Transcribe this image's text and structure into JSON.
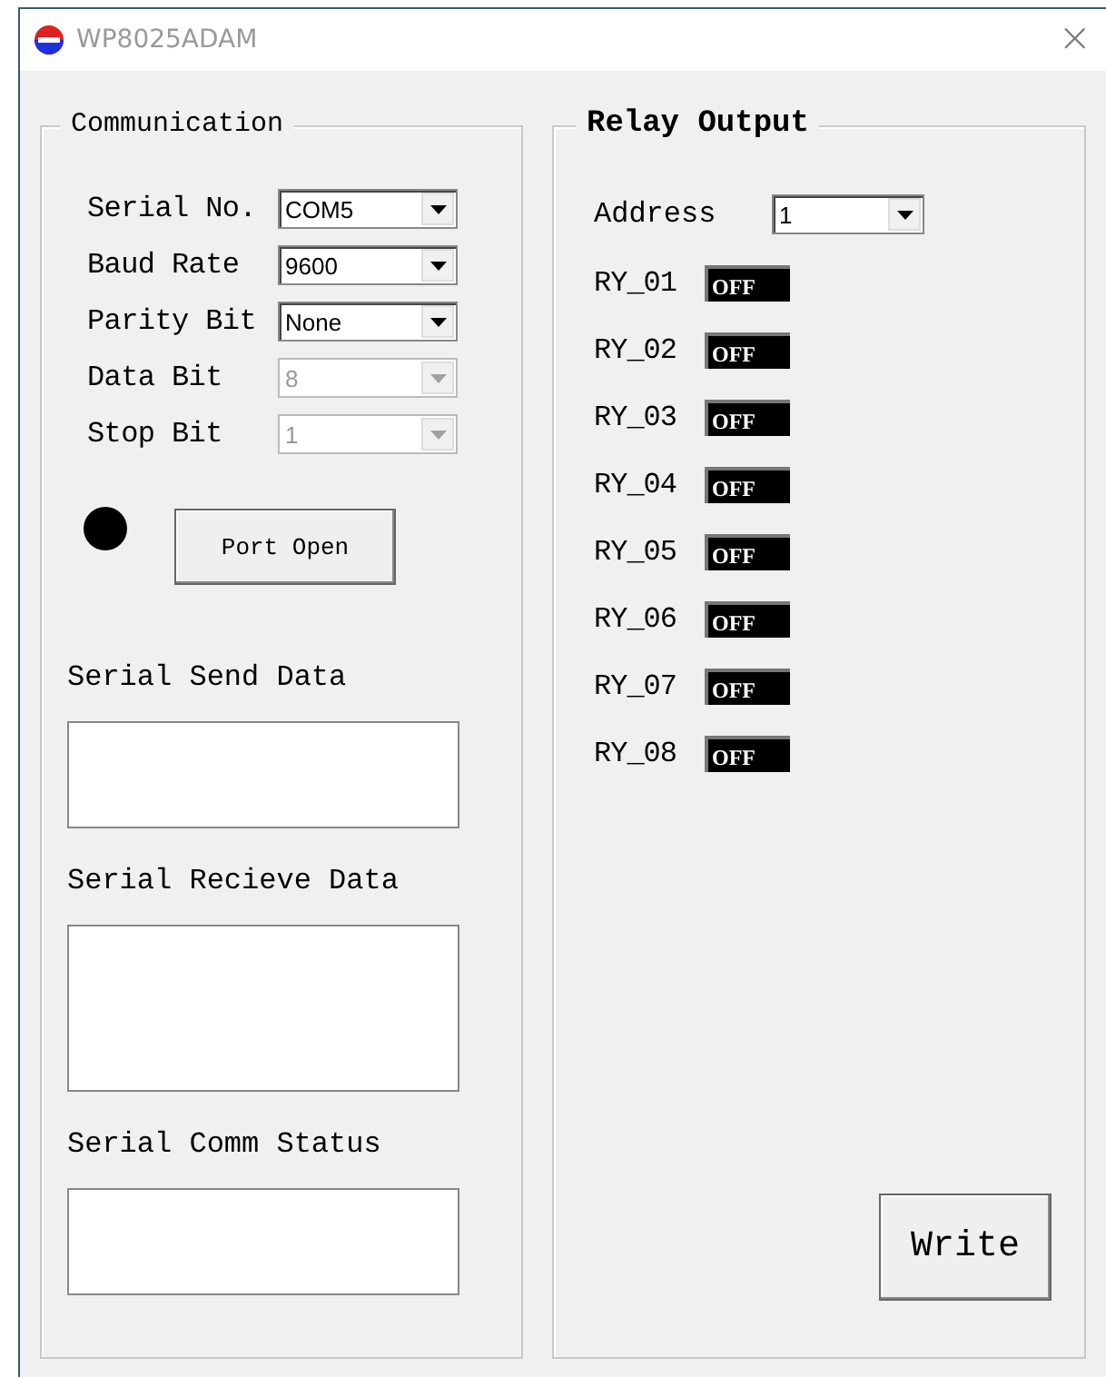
{
  "window": {
    "title": "WP8025ADAM",
    "close": "×"
  },
  "communication": {
    "title": "Communication",
    "fields": [
      {
        "label": "Serial No.",
        "value": "COM5",
        "disabled": false
      },
      {
        "label": "Baud Rate",
        "value": "9600",
        "disabled": false
      },
      {
        "label": "Parity Bit",
        "value": "None",
        "disabled": false
      },
      {
        "label": "Data Bit",
        "value": "8",
        "disabled": true
      },
      {
        "label": "Stop Bit",
        "value": "1",
        "disabled": true
      }
    ],
    "indicator": {
      "on": false
    },
    "port_button": "Port Open",
    "send_label": "Serial Send Data",
    "receive_label": "Serial Recieve Data",
    "status_label": "Serial Comm Status"
  },
  "relay": {
    "title": "Relay Output",
    "address_label": "Address",
    "address": "1",
    "relays": [
      {
        "label": "RY_01",
        "state": "OFF",
        "on": false
      },
      {
        "label": "RY_02",
        "state": "OFF",
        "on": false
      },
      {
        "label": "RY_03",
        "state": "OFF",
        "on": false
      },
      {
        "label": "RY_04",
        "state": "OFF",
        "on": false
      },
      {
        "label": "RY_05",
        "state": "OFF",
        "on": false
      },
      {
        "label": "RY_06",
        "state": "OFF",
        "on": false
      },
      {
        "label": "RY_07",
        "state": "OFF",
        "on": false
      },
      {
        "label": "RY_08",
        "state": "OFF",
        "on": false
      }
    ],
    "write_button": "Write"
  }
}
